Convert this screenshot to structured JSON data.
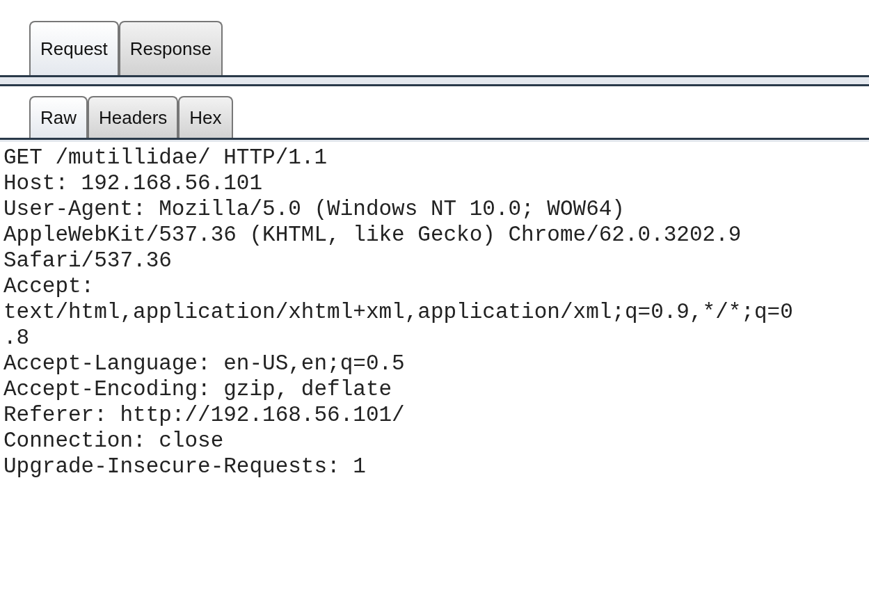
{
  "message_tabs": [
    {
      "label": "Request",
      "selected": true
    },
    {
      "label": "Response",
      "selected": false
    }
  ],
  "view_tabs": [
    {
      "label": "Raw",
      "selected": true
    },
    {
      "label": "Headers",
      "selected": false
    },
    {
      "label": "Hex",
      "selected": false
    }
  ],
  "raw_lines": [
    "GET /mutillidae/ HTTP/1.1",
    "Host: 192.168.56.101",
    "User-Agent: Mozilla/5.0 (Windows NT 10.0; WOW64)",
    "AppleWebKit/537.36 (KHTML, like Gecko) Chrome/62.0.3202.9",
    "Safari/537.36",
    "Accept:",
    "text/html,application/xhtml+xml,application/xml;q=0.9,*/*;q=0",
    ".8",
    "Accept-Language: en-US,en;q=0.5",
    "Accept-Encoding: gzip, deflate",
    "Referer: http://192.168.56.101/",
    "Connection: close",
    "Upgrade-Insecure-Requests: 1"
  ]
}
